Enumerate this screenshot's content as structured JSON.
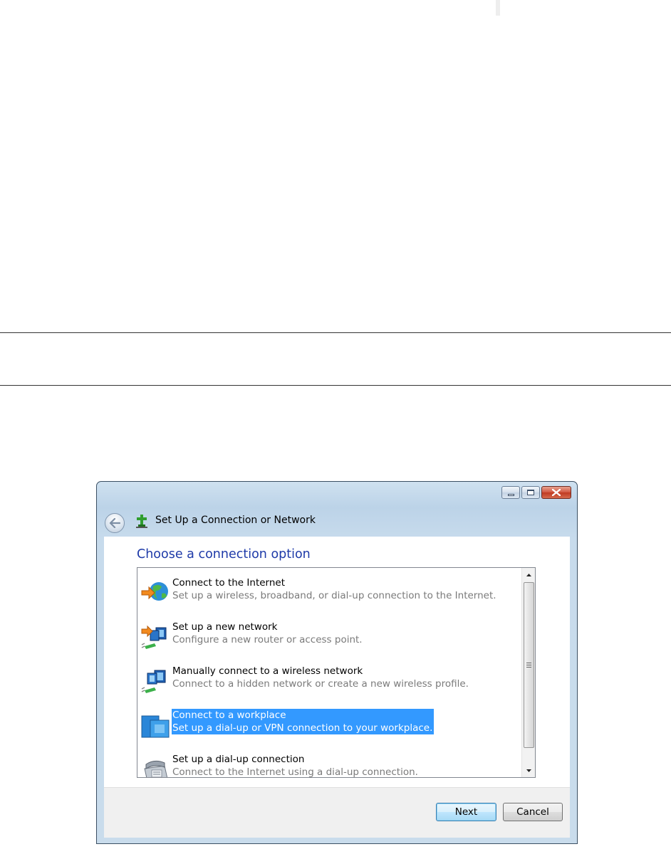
{
  "window": {
    "title": "Set Up a Connection or Network"
  },
  "content": {
    "heading": "Choose a connection option",
    "options": [
      {
        "title": "Connect to the Internet",
        "description": "Set up a wireless, broadband, or dial-up connection to the Internet.",
        "icon": "globe-arrow-icon",
        "selected": false
      },
      {
        "title": "Set up a new network",
        "description": "Configure a new router or access point.",
        "icon": "new-network-icon",
        "selected": false
      },
      {
        "title": "Manually connect to a wireless network",
        "description": "Connect to a hidden network or create a new wireless profile.",
        "icon": "wireless-network-icon",
        "selected": false
      },
      {
        "title": "Connect to a workplace",
        "description": "Set up a dial-up or VPN connection to your workplace.",
        "icon": "workplace-icon",
        "selected": true
      },
      {
        "title": "Set up a dial-up connection",
        "description": "Connect to the Internet using a dial-up connection.",
        "icon": "telephone-icon",
        "selected": false
      }
    ]
  },
  "footer": {
    "next_label": "Next",
    "cancel_label": "Cancel"
  },
  "colors": {
    "heading": "#1e3aa8",
    "selection": "#3399ff",
    "description_text": "#7a7a7a"
  }
}
